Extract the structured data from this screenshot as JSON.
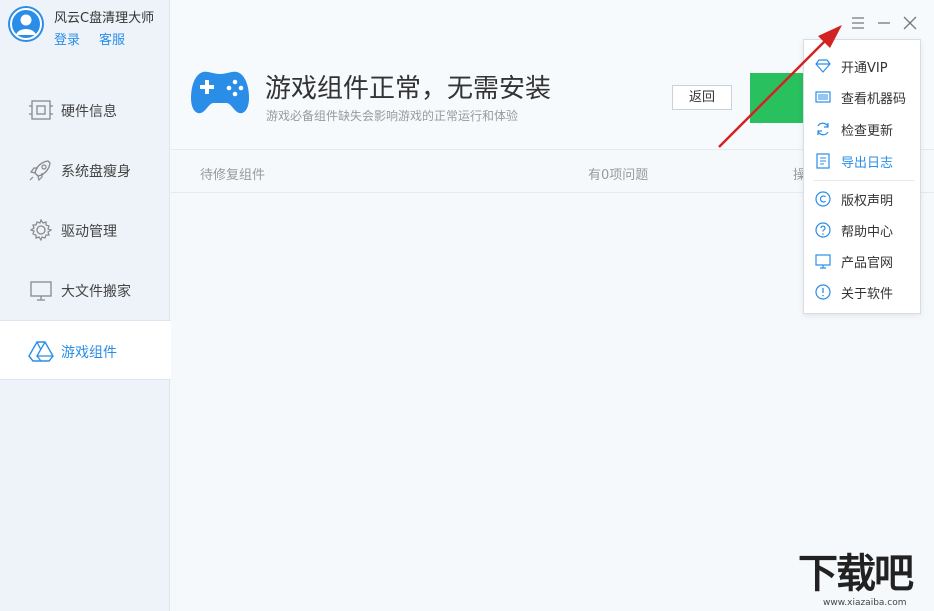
{
  "user": {
    "app_name": "风云C盘清理大师",
    "login": "登录",
    "service": "客服"
  },
  "sidebar": {
    "items": [
      {
        "label": "硬件信息",
        "icon": "hardware-icon"
      },
      {
        "label": "系统盘瘦身",
        "icon": "rocket-icon"
      },
      {
        "label": "驱动管理",
        "icon": "gear-icon"
      },
      {
        "label": "大文件搬家",
        "icon": "monitor-icon"
      },
      {
        "label": "游戏组件",
        "icon": "triangle-drive-icon",
        "active": true
      }
    ]
  },
  "header": {
    "title": "游戏组件正常，无需安装",
    "subtitle": "游戏必备组件缺失会影响游戏的正常运行和体验",
    "back_label": "返回"
  },
  "table": {
    "col1": "待修复组件",
    "col2": "有0项问题",
    "col3": "操"
  },
  "menu": {
    "items": [
      {
        "label": "开通VIP",
        "icon": "diamond-icon"
      },
      {
        "label": "查看机器码",
        "icon": "barcode-icon"
      },
      {
        "label": "检查更新",
        "icon": "refresh-icon"
      },
      {
        "label": "导出日志",
        "icon": "log-icon",
        "highlight": true
      },
      {
        "label": "版权声明",
        "icon": "copyright-icon"
      },
      {
        "label": "帮助中心",
        "icon": "help-icon"
      },
      {
        "label": "产品官网",
        "icon": "website-icon"
      },
      {
        "label": "关于软件",
        "icon": "info-icon"
      }
    ]
  },
  "watermark": {
    "big": "下载吧",
    "small": "www.xiazaiba.com"
  },
  "colors": {
    "accent": "#2a8ee8",
    "green": "#29c160",
    "arrow": "#d32222"
  }
}
